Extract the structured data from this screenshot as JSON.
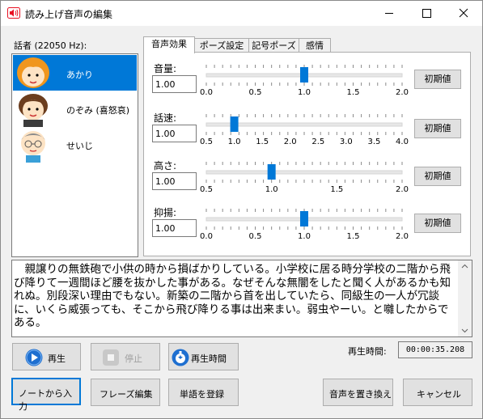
{
  "window": {
    "title": "読み上げ音声の編集"
  },
  "speakers": {
    "label": "話者 (22050 Hz):",
    "items": [
      {
        "name": "あかり",
        "selected": true
      },
      {
        "name": "のぞみ (喜怒哀)",
        "selected": false
      },
      {
        "name": "せいじ",
        "selected": false
      }
    ]
  },
  "tabs": [
    {
      "label": "音声効果",
      "active": true
    },
    {
      "label": "ポーズ設定",
      "active": false
    },
    {
      "label": "記号ポーズ",
      "active": false
    },
    {
      "label": "感情",
      "active": false
    }
  ],
  "params": [
    {
      "label": "音量:",
      "value": "1.00",
      "ticks": [
        "0.0",
        "0.5",
        "1.0",
        "1.5",
        "2.0"
      ],
      "min": 0.0,
      "max": 2.0,
      "current": 1.0,
      "reset_label": "初期値"
    },
    {
      "label": "話速:",
      "value": "1.00",
      "ticks": [
        "0.5",
        "1.0",
        "1.5",
        "2.0",
        "2.5",
        "3.0",
        "3.5",
        "4.0"
      ],
      "min": 0.5,
      "max": 4.0,
      "current": 1.0,
      "reset_label": "初期値"
    },
    {
      "label": "高さ:",
      "value": "1.00",
      "ticks": [
        "0.5",
        "1.0",
        "1.5",
        "2.0"
      ],
      "min": 0.5,
      "max": 2.0,
      "current": 1.0,
      "reset_label": "初期値"
    },
    {
      "label": "抑揚:",
      "value": "1.00",
      "ticks": [
        "0.0",
        "0.5",
        "1.0",
        "1.5",
        "2.0"
      ],
      "min": 0.0,
      "max": 2.0,
      "current": 1.0,
      "reset_label": "初期値"
    }
  ],
  "text": "　親譲りの無鉄砲で小供の時から損ばかりしている。小学校に居る時分学校の二階から飛び降りて一週間ほど腰を抜かした事がある。なぜそんな無闇をしたと聞く人があるかも知れぬ。別段深い理由でもない。新築の二階から首を出していたら、同級生の一人が冗談に、いくら威張っても、そこから飛び降りる事は出来まい。弱虫やーい。と囃したからである。",
  "playback": {
    "play_label": "再生",
    "stop_label": "停止",
    "time_button_label": "再生時間",
    "time_label": "再生時間:",
    "time_value": "00:00:35.208"
  },
  "actions": {
    "note_input": "ノートから入力",
    "phrase_edit": "フレーズ編集",
    "register_word": "単語を登録",
    "replace_voice": "音声を置き換え",
    "cancel": "キャンセル"
  },
  "colors": {
    "accent": "#0078d7",
    "play_blue": "#1e6fd0",
    "icon_red": "#e81123"
  }
}
